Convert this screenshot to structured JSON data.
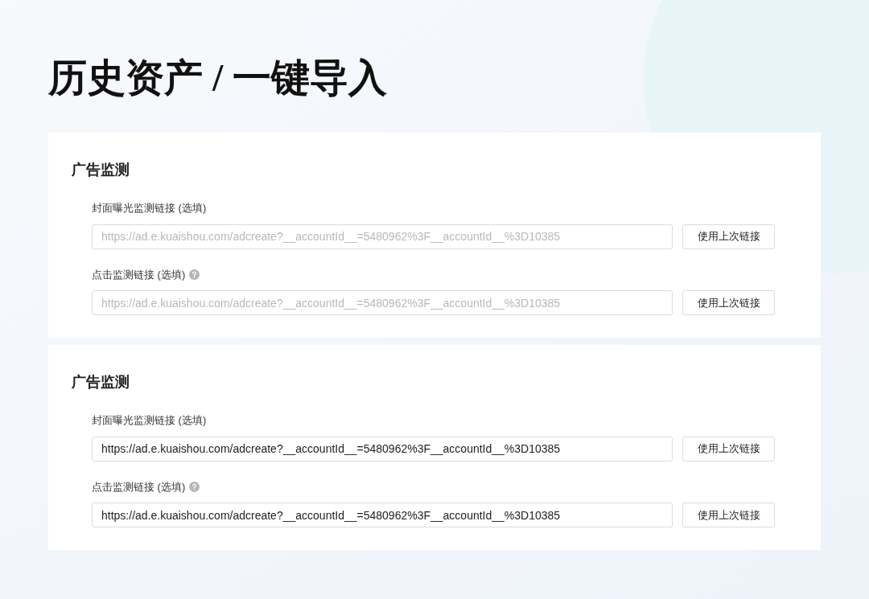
{
  "page_title": "历史资产 / 一键导入",
  "sections": [
    {
      "heading": "广告监测",
      "fields": [
        {
          "label": "封面曝光监测链接 (选填)",
          "help": false,
          "placeholder": "https://ad.e.kuaishou.com/adcreate?__accountId__=5480962%3F__accountId__%3D10385",
          "button": "使用上次链接"
        },
        {
          "label": "点击监测链接 (选填)",
          "help": true,
          "placeholder": "https://ad.e.kuaishou.com/adcreate?__accountId__=5480962%3F__accountId__%3D10385",
          "button": "使用上次链接"
        }
      ]
    },
    {
      "heading": "广告监测",
      "fields": [
        {
          "label": "封面曝光监测链接 (选填)",
          "help": false,
          "value": "https://ad.e.kuaishou.com/adcreate?__accountId__=5480962%3F__accountId__%3D10385",
          "button": "使用上次链接"
        },
        {
          "label": "点击监测链接 (选填)",
          "help": true,
          "value": "https://ad.e.kuaishou.com/adcreate?__accountId__=5480962%3F__accountId__%3D10385",
          "button": "使用上次链接"
        }
      ]
    }
  ]
}
